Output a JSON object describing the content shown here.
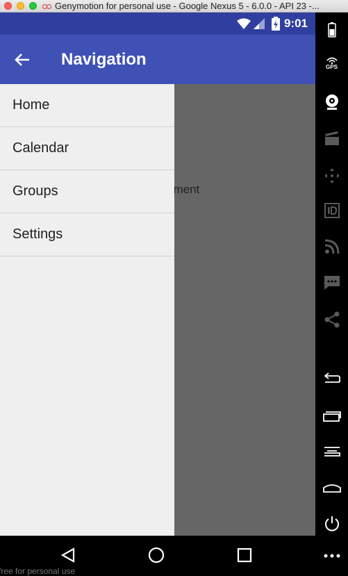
{
  "window": {
    "title": "Genymotion for personal use - Google Nexus 5 - 6.0.0 - API 23 -..."
  },
  "statusbar": {
    "time": "9:01"
  },
  "appbar": {
    "title": "Navigation"
  },
  "content": {
    "fragment_text": "gment"
  },
  "drawer": {
    "items": [
      {
        "label": "Home"
      },
      {
        "label": "Calendar"
      },
      {
        "label": "Groups"
      },
      {
        "label": "Settings"
      }
    ]
  },
  "toolbar": {
    "gps_label": "GPS"
  },
  "footer": {
    "watermark": "free for personal use"
  },
  "colors": {
    "primary": "#3f51b5",
    "primary_dark": "#303f9f",
    "drawer_bg": "#efefef",
    "scrim": "#666666"
  }
}
